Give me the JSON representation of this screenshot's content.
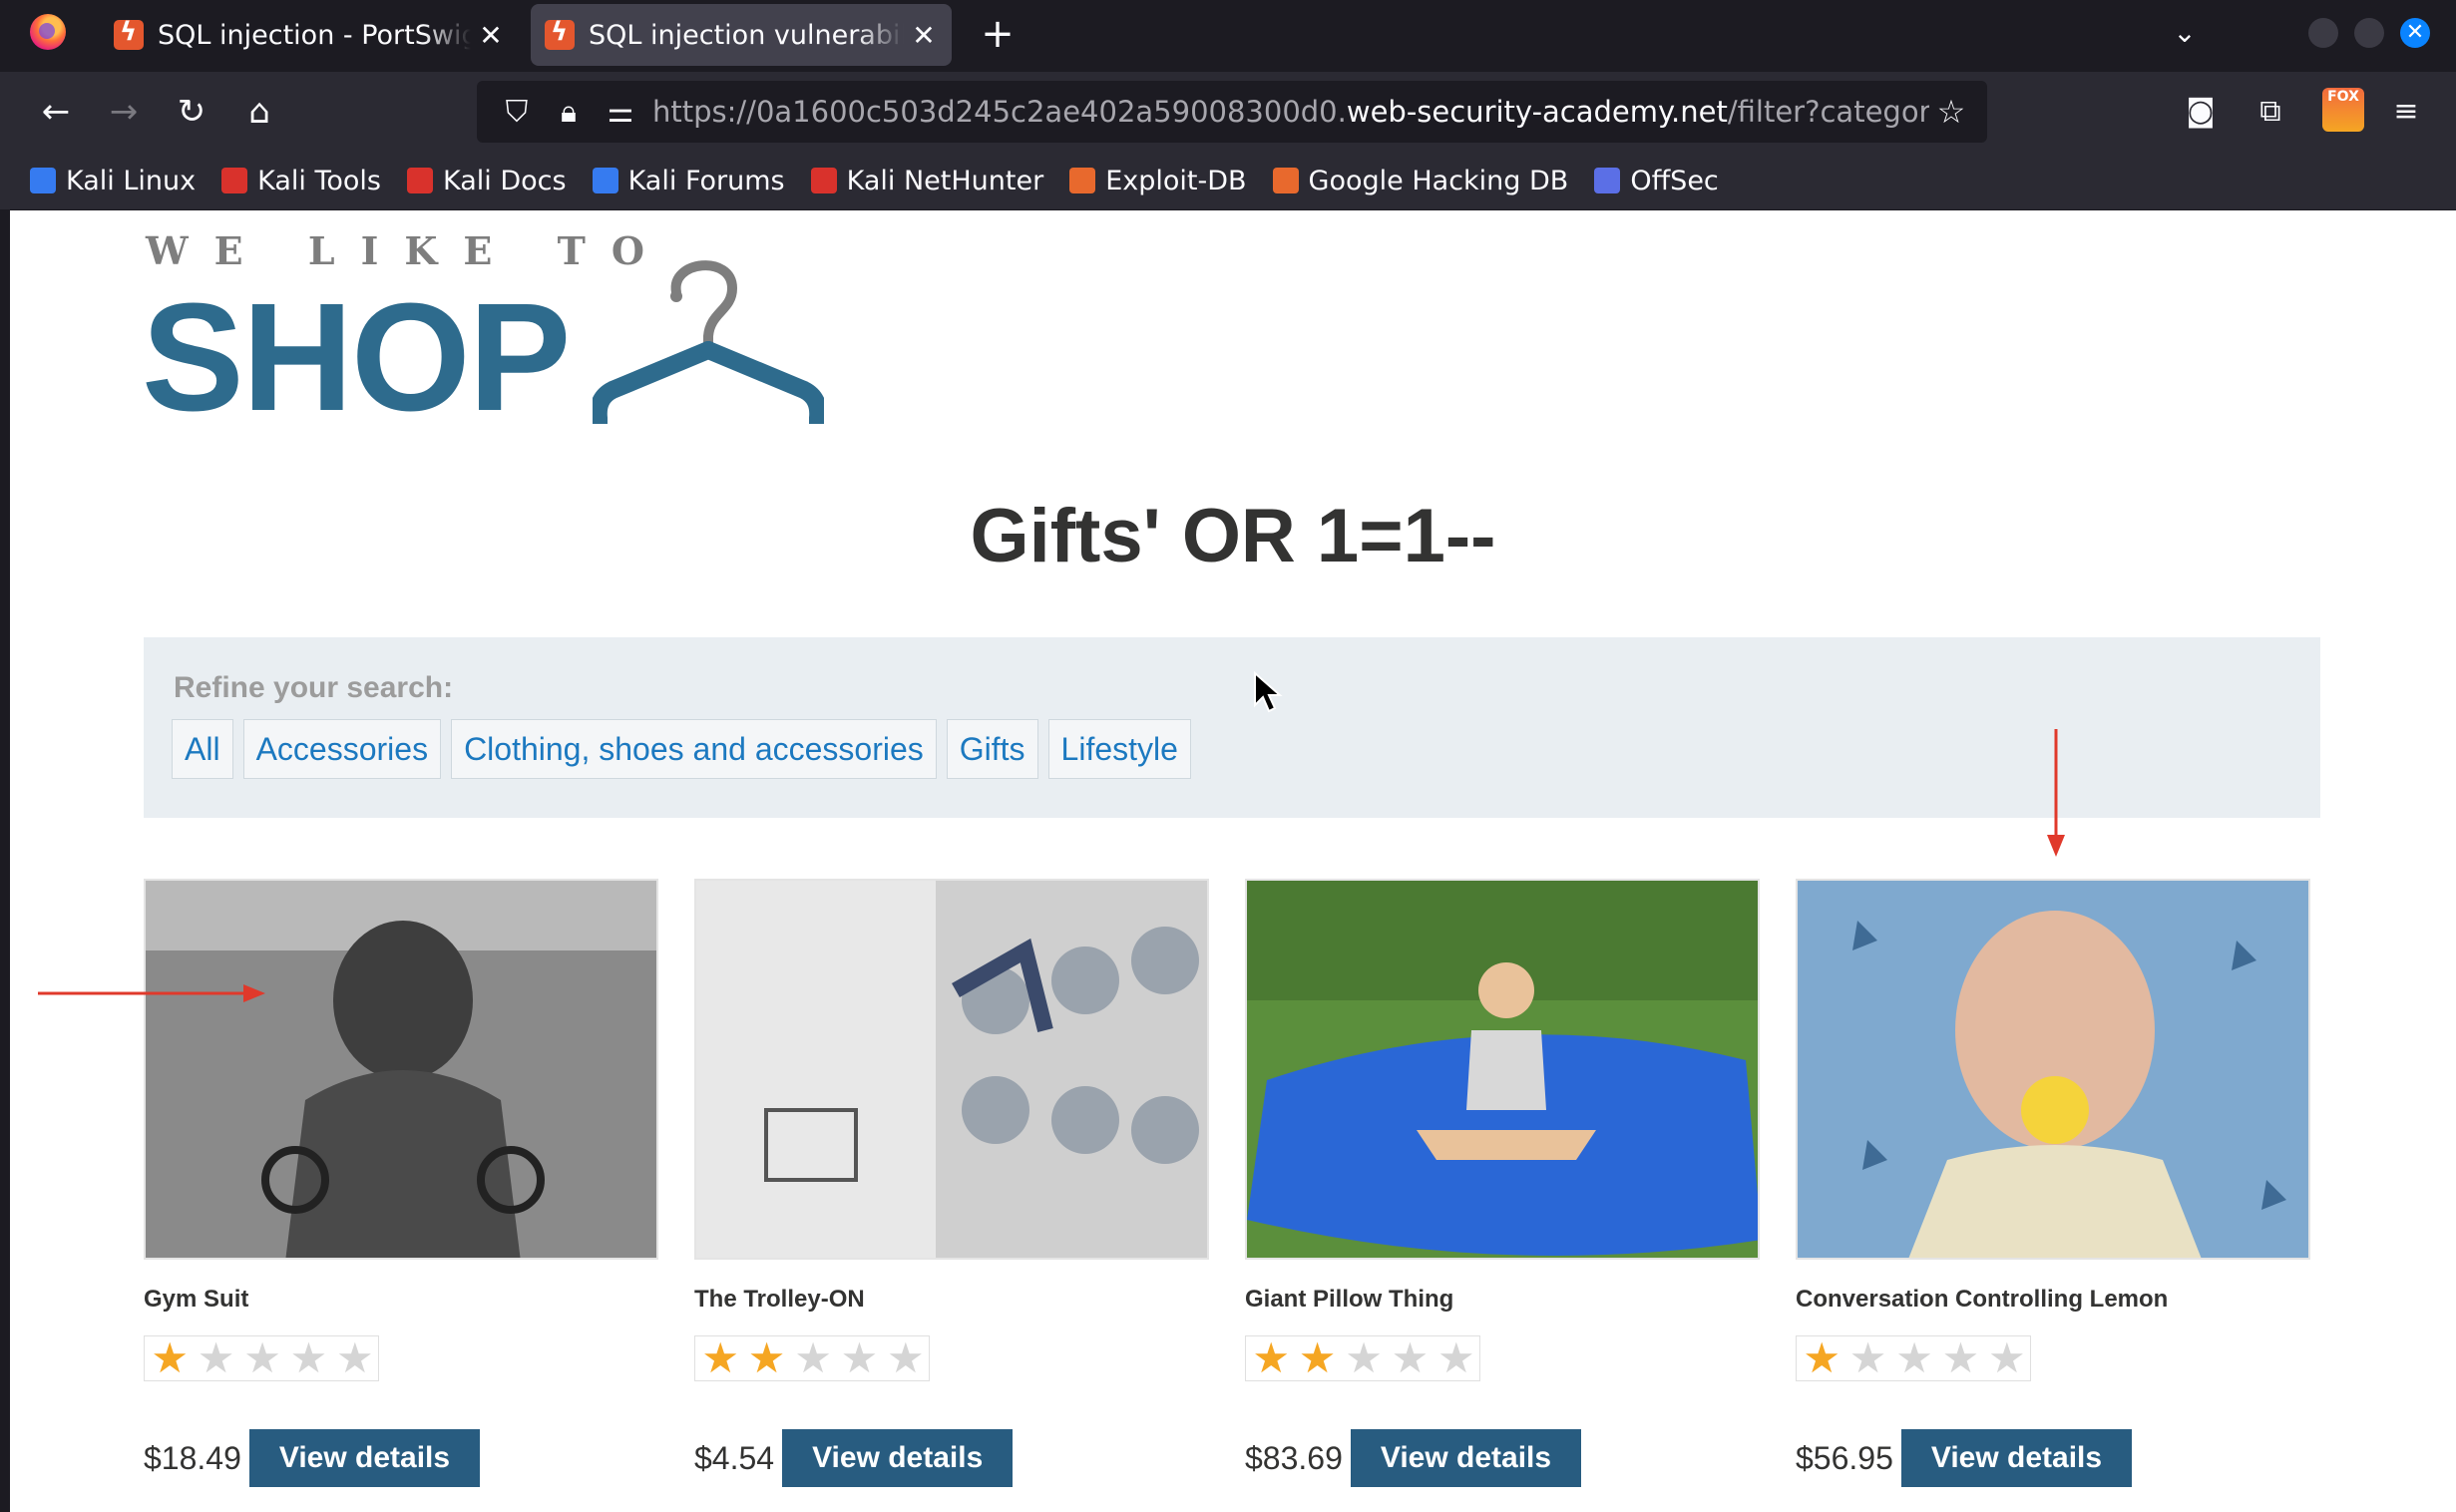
{
  "browser": {
    "tabs": [
      {
        "title": "SQL injection - PortSwigger",
        "active": false
      },
      {
        "title": "SQL injection vulnerability in WHERE clause",
        "active": true
      }
    ],
    "url": {
      "prefix": "https://0a1600c503d245c2ae402a59008300d0.",
      "domain": "web-security-academy.net",
      "path": "/filter?category=Gifts"
    },
    "bookmarks": [
      {
        "label": "Kali Linux",
        "color": "#367bf0"
      },
      {
        "label": "Kali Tools",
        "color": "#d9322c"
      },
      {
        "label": "Kali Docs",
        "color": "#d9322c"
      },
      {
        "label": "Kali Forums",
        "color": "#367bf0"
      },
      {
        "label": "Kali NetHunter",
        "color": "#d9322c"
      },
      {
        "label": "Exploit-DB",
        "color": "#e8692d"
      },
      {
        "label": "Google Hacking DB",
        "color": "#e8692d"
      },
      {
        "label": "OffSec",
        "color": "#5b6fe6"
      }
    ],
    "fox_badge": "FOX"
  },
  "site": {
    "logo_tagline": "WE LIKE TO",
    "logo_word": "SHOP",
    "heading": "Gifts' OR 1=1--",
    "filter_label": "Refine your search:",
    "categories": [
      "All",
      "Accessories",
      "Clothing, shoes and accessories",
      "Gifts",
      "Lifestyle"
    ],
    "products": [
      {
        "name": "Gym Suit",
        "rating": 1,
        "price": "$18.49",
        "button": "View details",
        "image": "muscular-dog-gym-photo"
      },
      {
        "name": "The Trolley-ON",
        "rating": 2,
        "price": "$4.54",
        "button": "View details",
        "image": "laundromat-trolley-photo"
      },
      {
        "name": "Giant Pillow Thing",
        "rating": 2,
        "price": "$83.69",
        "button": "View details",
        "image": "girl-on-blue-pillow-photo"
      },
      {
        "name": "Conversation Controlling Lemon",
        "rating": 1,
        "price": "$56.95",
        "button": "View details",
        "image": "man-biting-lemon-photo"
      }
    ]
  },
  "colors": {
    "brand": "#2e6b8d",
    "button": "#285c80",
    "link": "#1c79c0",
    "star": "#f5a623",
    "annotation": "#e0392b"
  }
}
